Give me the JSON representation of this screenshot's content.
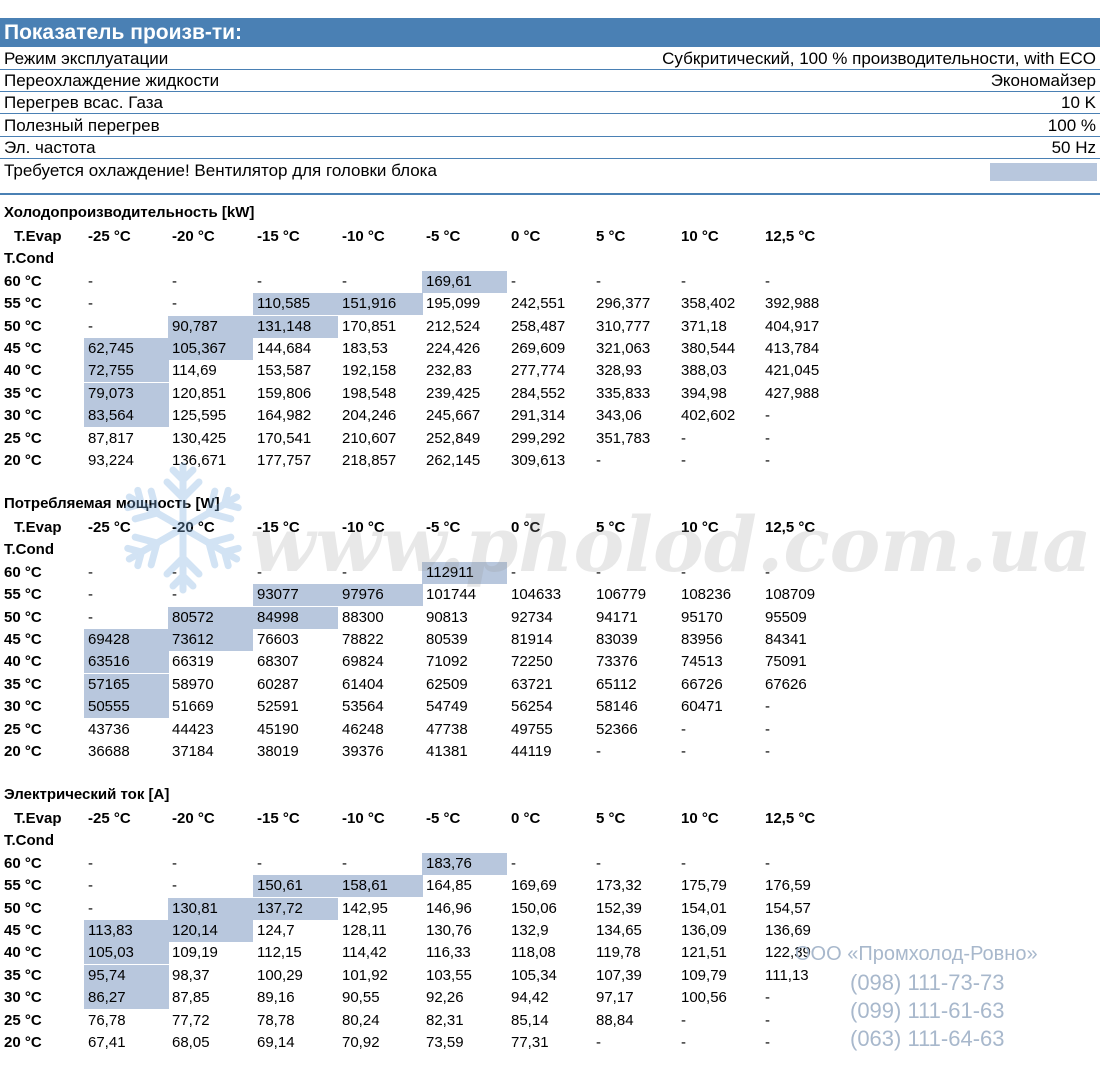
{
  "header": {
    "title": "Показатель произв-ти:"
  },
  "params": [
    {
      "label": "Режим эксплуатации",
      "value": "Субкритический, 100 % производительности, with ECO"
    },
    {
      "label": "Переохлаждение жидкости",
      "value": "Экономайзер"
    },
    {
      "label": "Перегрев всас. Газа",
      "value": "10 K"
    },
    {
      "label": "Полезный перегрев",
      "value": "100 %"
    },
    {
      "label": "Эл. частота",
      "value": "50 Hz"
    },
    {
      "label": "Требуется охлаждение! Вентилятор для головки блока",
      "value": ""
    }
  ],
  "colors": {
    "accent": "#4a80b4",
    "highlight": "#b8c7dd"
  },
  "tables": [
    {
      "title": "Холодопроизводительность [kW]",
      "evap_label": "T.Evap",
      "cond_label": "T.Cond",
      "columns": [
        "-25 °C",
        "-20 °C",
        "-15 °C",
        "-10 °C",
        "-5 °C",
        "0 °C",
        "5 °C",
        "10 °C",
        "12,5 °C"
      ],
      "rows": [
        {
          "label": "60 °C",
          "values": [
            "-",
            "-",
            "-",
            "-",
            "169,61",
            "-",
            "-",
            "-",
            "-"
          ],
          "hl": [
            4
          ]
        },
        {
          "label": "55 °C",
          "values": [
            "-",
            "-",
            "110,585",
            "151,916",
            "195,099",
            "242,551",
            "296,377",
            "358,402",
            "392,988"
          ],
          "hl": [
            2,
            3
          ]
        },
        {
          "label": "50 °C",
          "values": [
            "-",
            "90,787",
            "131,148",
            "170,851",
            "212,524",
            "258,487",
            "310,777",
            "371,18",
            "404,917"
          ],
          "hl": [
            1,
            2
          ]
        },
        {
          "label": "45 °C",
          "values": [
            "62,745",
            "105,367",
            "144,684",
            "183,53",
            "224,426",
            "269,609",
            "321,063",
            "380,544",
            "413,784"
          ],
          "hl": [
            0,
            1
          ]
        },
        {
          "label": "40 °C",
          "values": [
            "72,755",
            "114,69",
            "153,587",
            "192,158",
            "232,83",
            "277,774",
            "328,93",
            "388,03",
            "421,045"
          ],
          "hl": [
            0
          ]
        },
        {
          "label": "35 °C",
          "values": [
            "79,073",
            "120,851",
            "159,806",
            "198,548",
            "239,425",
            "284,552",
            "335,833",
            "394,98",
            "427,988"
          ],
          "hl": [
            0
          ]
        },
        {
          "label": "30 °C",
          "values": [
            "83,564",
            "125,595",
            "164,982",
            "204,246",
            "245,667",
            "291,314",
            "343,06",
            "402,602",
            "-"
          ],
          "hl": [
            0
          ]
        },
        {
          "label": "25 °C",
          "values": [
            "87,817",
            "130,425",
            "170,541",
            "210,607",
            "252,849",
            "299,292",
            "351,783",
            "-",
            "-"
          ],
          "hl": []
        },
        {
          "label": "20 °C",
          "values": [
            "93,224",
            "136,671",
            "177,757",
            "218,857",
            "262,145",
            "309,613",
            "-",
            "-",
            "-"
          ],
          "hl": []
        }
      ]
    },
    {
      "title": "Потребляемая мощность [W]",
      "evap_label": "T.Evap",
      "cond_label": "T.Cond",
      "columns": [
        "-25 °C",
        "-20 °C",
        "-15 °C",
        "-10 °C",
        "-5 °C",
        "0 °C",
        "5 °C",
        "10 °C",
        "12,5 °C"
      ],
      "rows": [
        {
          "label": "60 °C",
          "values": [
            "-",
            "-",
            "-",
            "-",
            "112911",
            "-",
            "-",
            "-",
            "-"
          ],
          "hl": [
            4
          ]
        },
        {
          "label": "55 °C",
          "values": [
            "-",
            "-",
            "93077",
            "97976",
            "101744",
            "104633",
            "106779",
            "108236",
            "108709"
          ],
          "hl": [
            2,
            3
          ]
        },
        {
          "label": "50 °C",
          "values": [
            "-",
            "80572",
            "84998",
            "88300",
            "90813",
            "92734",
            "94171",
            "95170",
            "95509"
          ],
          "hl": [
            1,
            2
          ]
        },
        {
          "label": "45 °C",
          "values": [
            "69428",
            "73612",
            "76603",
            "78822",
            "80539",
            "81914",
            "83039",
            "83956",
            "84341"
          ],
          "hl": [
            0,
            1
          ]
        },
        {
          "label": "40 °C",
          "values": [
            "63516",
            "66319",
            "68307",
            "69824",
            "71092",
            "72250",
            "73376",
            "74513",
            "75091"
          ],
          "hl": [
            0
          ]
        },
        {
          "label": "35 °C",
          "values": [
            "57165",
            "58970",
            "60287",
            "61404",
            "62509",
            "63721",
            "65112",
            "66726",
            "67626"
          ],
          "hl": [
            0
          ]
        },
        {
          "label": "30 °C",
          "values": [
            "50555",
            "51669",
            "52591",
            "53564",
            "54749",
            "56254",
            "58146",
            "60471",
            "-"
          ],
          "hl": [
            0
          ]
        },
        {
          "label": "25 °C",
          "values": [
            "43736",
            "44423",
            "45190",
            "46248",
            "47738",
            "49755",
            "52366",
            "-",
            "-"
          ],
          "hl": []
        },
        {
          "label": "20 °C",
          "values": [
            "36688",
            "37184",
            "38019",
            "39376",
            "41381",
            "44119",
            "-",
            "-",
            "-"
          ],
          "hl": []
        }
      ]
    },
    {
      "title": "Электрический ток [A]",
      "evap_label": "T.Evap",
      "cond_label": "T.Cond",
      "columns": [
        "-25 °C",
        "-20 °C",
        "-15 °C",
        "-10 °C",
        "-5 °C",
        "0 °C",
        "5 °C",
        "10 °C",
        "12,5 °C"
      ],
      "rows": [
        {
          "label": "60 °C",
          "values": [
            "-",
            "-",
            "-",
            "-",
            "183,76",
            "-",
            "-",
            "-",
            "-"
          ],
          "hl": [
            4
          ]
        },
        {
          "label": "55 °C",
          "values": [
            "-",
            "-",
            "150,61",
            "158,61",
            "164,85",
            "169,69",
            "173,32",
            "175,79",
            "176,59"
          ],
          "hl": [
            2,
            3
          ]
        },
        {
          "label": "50 °C",
          "values": [
            "-",
            "130,81",
            "137,72",
            "142,95",
            "146,96",
            "150,06",
            "152,39",
            "154,01",
            "154,57"
          ],
          "hl": [
            1,
            2
          ]
        },
        {
          "label": "45 °C",
          "values": [
            "113,83",
            "120,14",
            "124,7",
            "128,11",
            "130,76",
            "132,9",
            "134,65",
            "136,09",
            "136,69"
          ],
          "hl": [
            0,
            1
          ]
        },
        {
          "label": "40 °C",
          "values": [
            "105,03",
            "109,19",
            "112,15",
            "114,42",
            "116,33",
            "118,08",
            "119,78",
            "121,51",
            "122,39"
          ],
          "hl": [
            0
          ]
        },
        {
          "label": "35 °C",
          "values": [
            "95,74",
            "98,37",
            "100,29",
            "101,92",
            "103,55",
            "105,34",
            "107,39",
            "109,79",
            "111,13"
          ],
          "hl": [
            0
          ]
        },
        {
          "label": "30 °C",
          "values": [
            "86,27",
            "87,85",
            "89,16",
            "90,55",
            "92,26",
            "94,42",
            "97,17",
            "100,56",
            "-"
          ],
          "hl": [
            0
          ]
        },
        {
          "label": "25 °C",
          "values": [
            "76,78",
            "77,72",
            "78,78",
            "80,24",
            "82,31",
            "85,14",
            "88,84",
            "-",
            "-"
          ],
          "hl": []
        },
        {
          "label": "20 °C",
          "values": [
            "67,41",
            "68,05",
            "69,14",
            "70,92",
            "73,59",
            "77,31",
            "-",
            "-",
            "-"
          ],
          "hl": []
        }
      ]
    }
  ],
  "watermark": {
    "text": "www.pholod.com.ua"
  },
  "contact": {
    "company": "ООО «Промхолод-Ровно»",
    "phones": [
      "(098) 111-73-73",
      "(099) 111-61-63",
      "(063) 111-64-63"
    ]
  }
}
